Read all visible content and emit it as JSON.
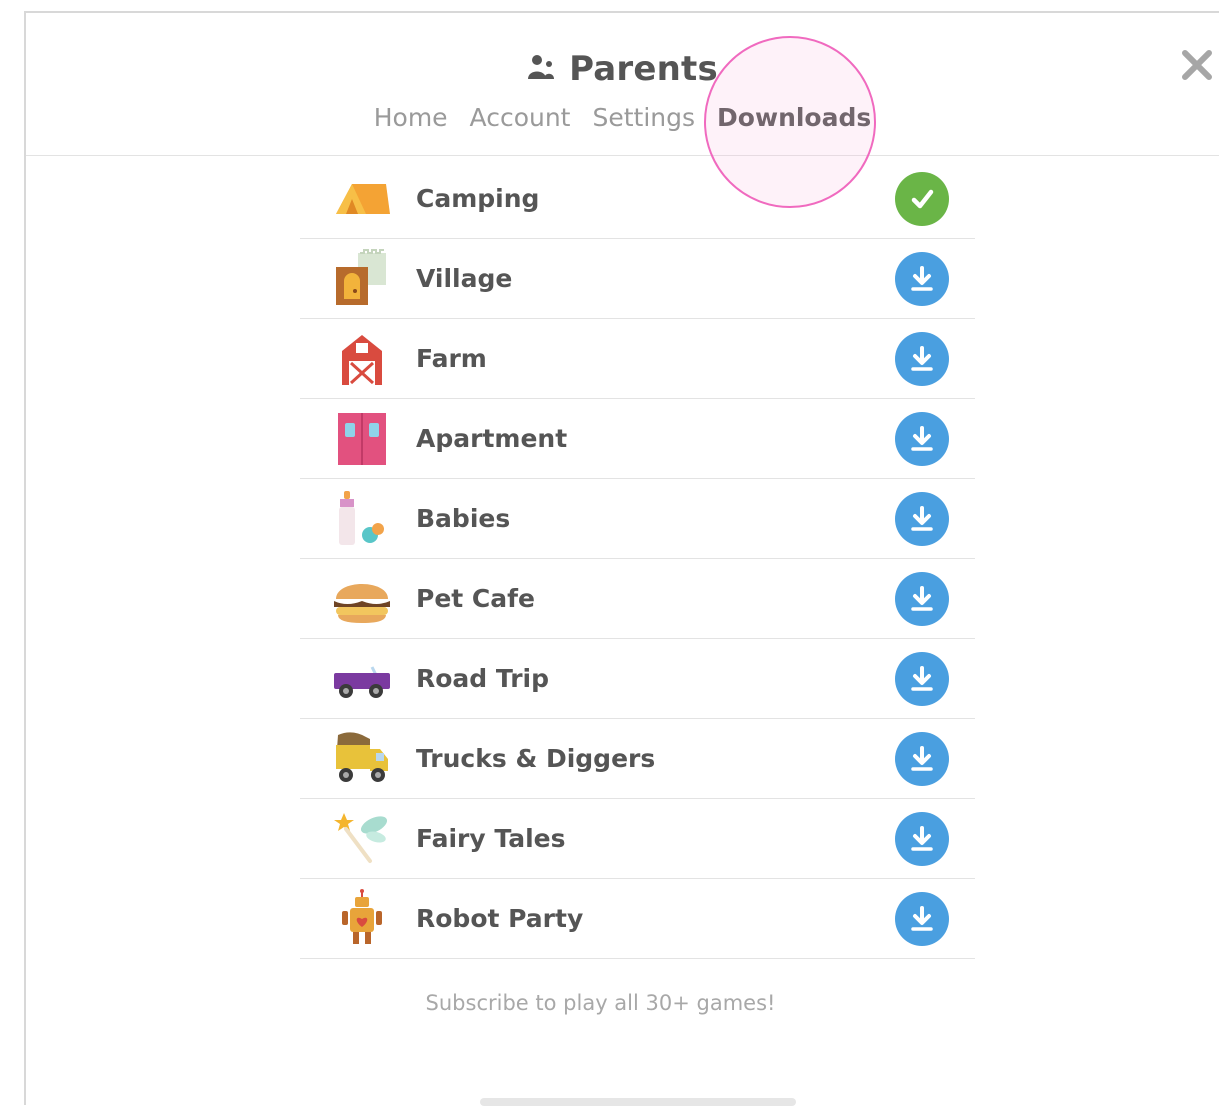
{
  "header": {
    "title": "Parents",
    "icon": "parents-icon",
    "tabs": [
      {
        "label": "Home",
        "active": false
      },
      {
        "label": "Account",
        "active": false
      },
      {
        "label": "Settings",
        "active": false
      },
      {
        "label": "Downloads",
        "active": true
      }
    ],
    "close_icon": "close-icon"
  },
  "games": [
    {
      "name": "Camping",
      "icon": "tent-icon",
      "status": "downloaded"
    },
    {
      "name": "Village",
      "icon": "village-icon",
      "status": "download"
    },
    {
      "name": "Farm",
      "icon": "barn-icon",
      "status": "download"
    },
    {
      "name": "Apartment",
      "icon": "apartment-door-icon",
      "status": "download"
    },
    {
      "name": "Babies",
      "icon": "baby-bottle-icon",
      "status": "download"
    },
    {
      "name": "Pet Cafe",
      "icon": "burger-icon",
      "status": "download"
    },
    {
      "name": "Road Trip",
      "icon": "car-icon",
      "status": "download"
    },
    {
      "name": "Trucks & Diggers",
      "icon": "dump-truck-icon",
      "status": "download"
    },
    {
      "name": "Fairy Tales",
      "icon": "magic-wand-icon",
      "status": "download"
    },
    {
      "name": "Robot Party",
      "icon": "robot-icon",
      "status": "download"
    }
  ],
  "footer": {
    "text": "Subscribe to play all 30+ games!"
  },
  "colors": {
    "done": "#6ab547",
    "download": "#4a9fe0",
    "highlight_ring": "#f06abf",
    "text": "#555555",
    "muted": "#9a9a9a"
  }
}
